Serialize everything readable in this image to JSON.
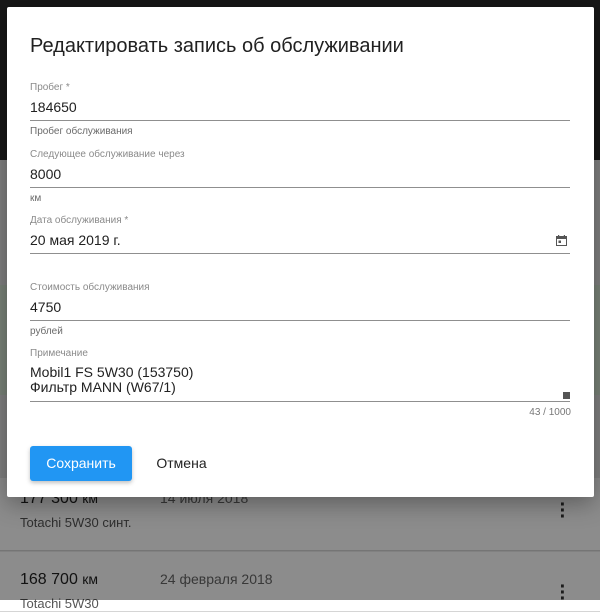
{
  "dialog": {
    "title": "Редактировать запись об обслуживании",
    "fields": {
      "mileage": {
        "label": "Пробег *",
        "value": "184650",
        "helper": "Пробег обслуживания"
      },
      "next_service": {
        "label": "Следующее обслуживание через",
        "value": "8000",
        "helper": "км"
      },
      "service_date": {
        "label": "Дата обслуживания *",
        "value": "20 мая 2019 г.",
        "icon": "calendar-icon"
      },
      "cost": {
        "label": "Стоимость обслуживания",
        "value": "4750",
        "helper": "рублей"
      },
      "note": {
        "label": "Примечание",
        "lines": [
          "Mobil1 FS 5W30 (153750)",
          "Фильтр MANN (W67/1)"
        ],
        "counter": "43 / 1000"
      }
    },
    "buttons": {
      "save": "Сохранить",
      "cancel": "Отмена"
    }
  },
  "background": {
    "records": [
      {
        "km": "177 300",
        "unit": "км",
        "date": "14 июля 2018",
        "oil": "Totachi 5W30 синт."
      },
      {
        "km": "168 700",
        "unit": "км",
        "date": "24 февраля 2018",
        "oil": "Totachi 5W30"
      }
    ],
    "menu_icon": "more-vert-icon"
  },
  "colors": {
    "primary": "#2196f3",
    "overlay": "rgba(0,0,0,0.45)"
  }
}
